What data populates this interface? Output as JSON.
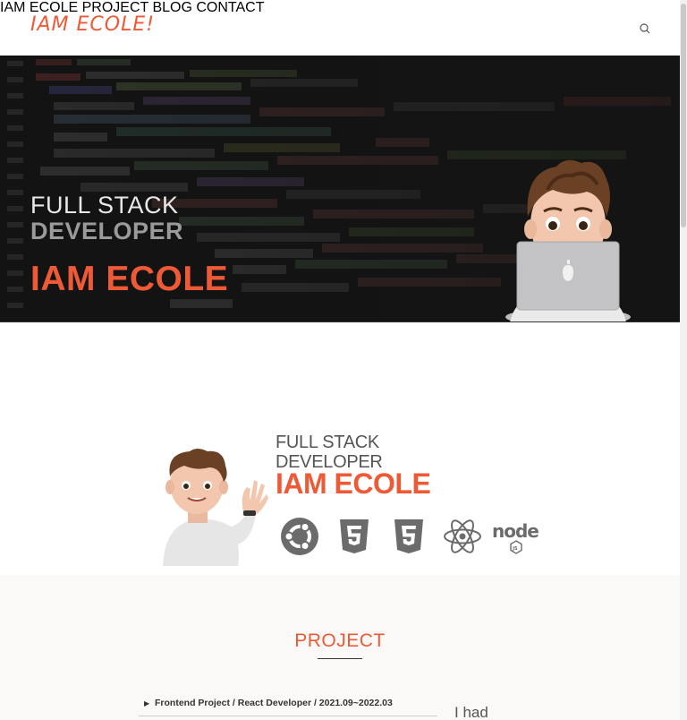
{
  "header": {
    "logo": "IAM ECOLE!",
    "nav": [
      {
        "label": "IAM ECOLE"
      },
      {
        "label": "PROJECT"
      },
      {
        "label": "BLOG"
      },
      {
        "label": "CONTACT"
      }
    ]
  },
  "hero": {
    "line1": "FULL STACK",
    "line2": "DEVELOPER",
    "line3": "IAM ECOLE"
  },
  "intro": {
    "line1": "FULL STACK",
    "line2": "DEVELOPER",
    "line3": "IAM ECOLE",
    "tech_icons": [
      "ubuntu-icon",
      "html5-icon",
      "css3-icon",
      "react-icon",
      "nodejs-icon"
    ]
  },
  "project": {
    "title": "PROJECT",
    "items": [
      {
        "label": "Frontend Project / React Developer / 2021.09~2022.03"
      }
    ],
    "side_text": "I had"
  },
  "colors": {
    "accent": "#ef5a36",
    "hero_bg": "#141414",
    "project_bg": "#faf9f7"
  }
}
